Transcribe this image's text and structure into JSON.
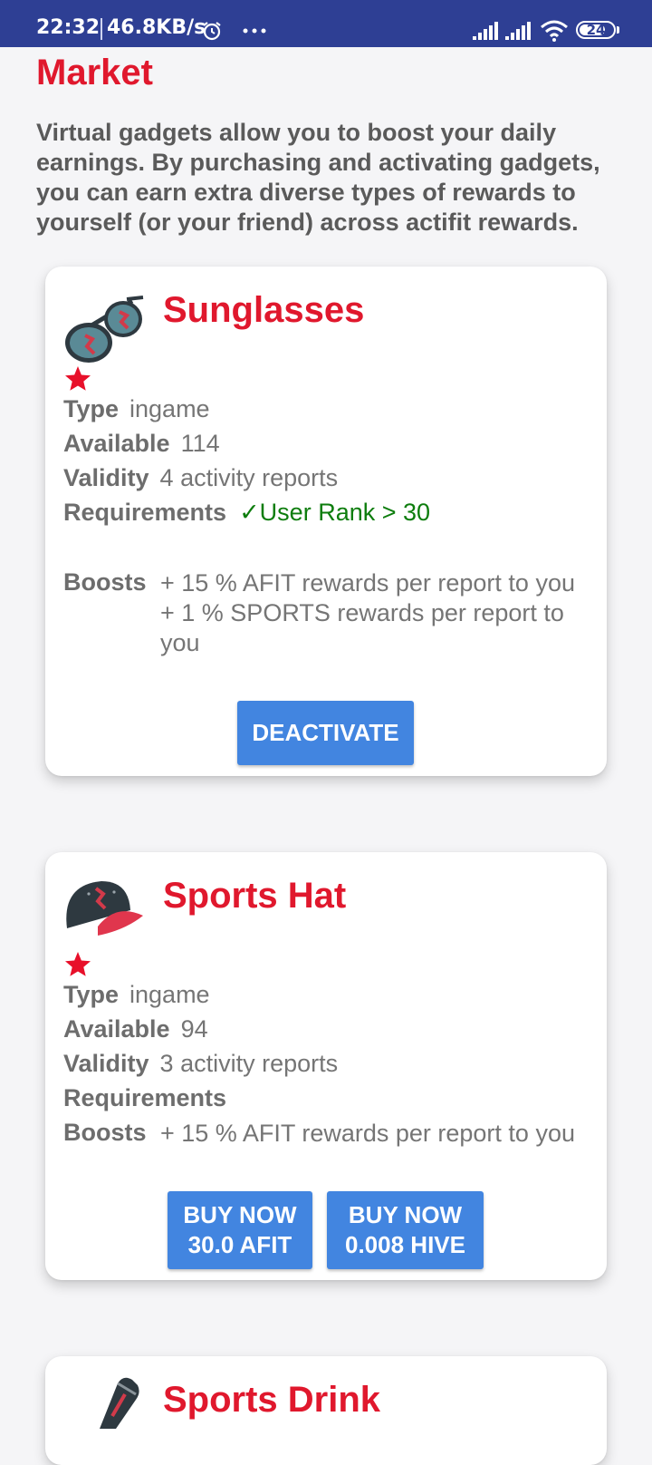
{
  "status_bar": {
    "time": "22:32",
    "network_speed": "46.8KB/s",
    "battery_level": "24",
    "icons": [
      "alarm-icon",
      "more-dots-icon",
      "signal-icon",
      "signal-icon",
      "wifi-icon",
      "battery-icon"
    ]
  },
  "page": {
    "title": "Market",
    "intro": "Virtual gadgets allow you to boost your daily earnings. By purchasing and activating gadgets, you can earn extra diverse types of rewards to yourself (or your friend) across actifit rewards."
  },
  "colors": {
    "accent_red": "#e0182d",
    "button_blue": "#4285e0",
    "status_bar": "#2e3f94",
    "requirement_ok": "#0d7d0d"
  },
  "labels": {
    "type": "Type",
    "available": "Available",
    "validity": "Validity",
    "requirements": "Requirements",
    "boosts": "Boosts"
  },
  "gadgets": [
    {
      "name": "Sunglasses",
      "icon": "sunglasses-icon",
      "star_icon": "star-icon",
      "type": "ingame",
      "available": "114",
      "validity": "4 activity reports",
      "requirement": "✓User Rank > 30",
      "boosts": [
        "+ 15 % AFIT rewards per report to you",
        "+ 1 % SPORTS rewards per report to you"
      ],
      "action": "DEACTIVATE"
    },
    {
      "name": "Sports Hat",
      "icon": "cap-icon",
      "star_icon": "star-icon",
      "type": "ingame",
      "available": "94",
      "validity": "3 activity reports",
      "requirement": "",
      "boosts": [
        "+ 15 % AFIT rewards per report to you"
      ],
      "buy_afit_line1": "BUY NOW",
      "buy_afit_line2": "30.0 AFIT",
      "buy_hive_line1": "BUY NOW",
      "buy_hive_line2": "0.008 HIVE"
    },
    {
      "name": "Sports Drink",
      "icon": "energy-drink-can-icon"
    }
  ]
}
